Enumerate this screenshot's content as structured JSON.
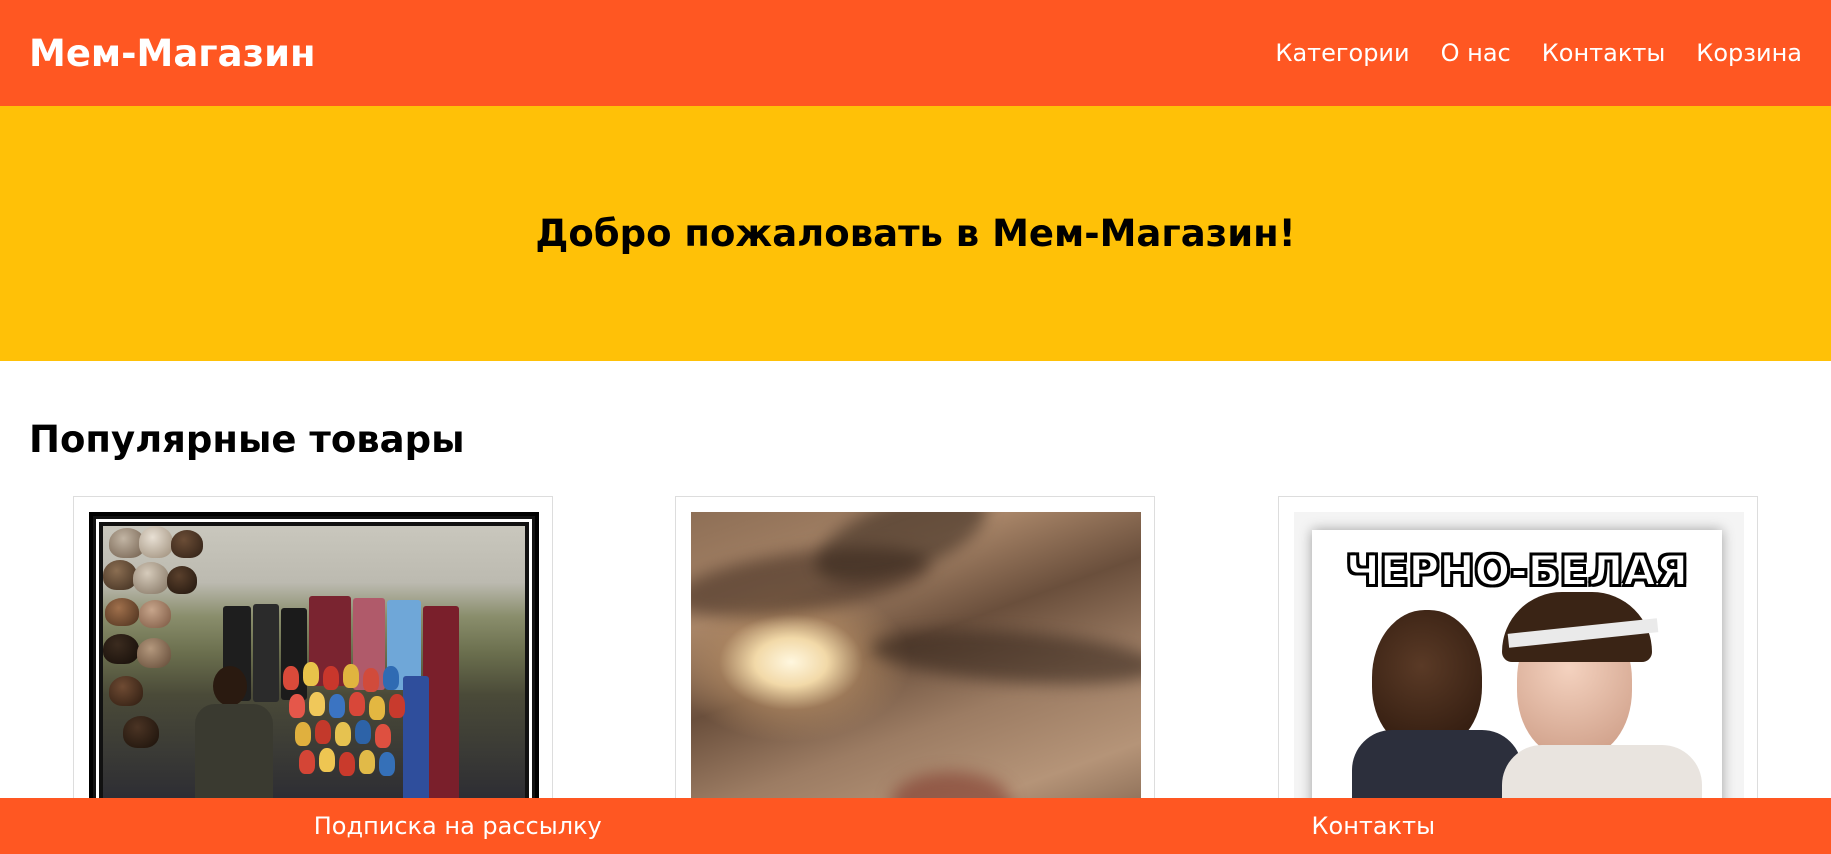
{
  "header": {
    "logo": "Мем-Магазин",
    "nav": [
      "Категории",
      "О нас",
      "Контакты",
      "Корзина"
    ]
  },
  "hero": {
    "title": "Добро пожаловать в Мем-Магазин!"
  },
  "popular": {
    "title": "Популярные товары",
    "products": [
      {
        "image": "market-stall-photo"
      },
      {
        "image": "blurry-light-photo"
      },
      {
        "image": "meme-poster-photo",
        "caption": "ЧЕРНО-БЕЛАЯ"
      }
    ]
  },
  "footer": {
    "links": [
      "Подписка на рассылку",
      "Контакты"
    ]
  },
  "colors": {
    "primary": "#ff5722",
    "hero": "#ffc107"
  }
}
